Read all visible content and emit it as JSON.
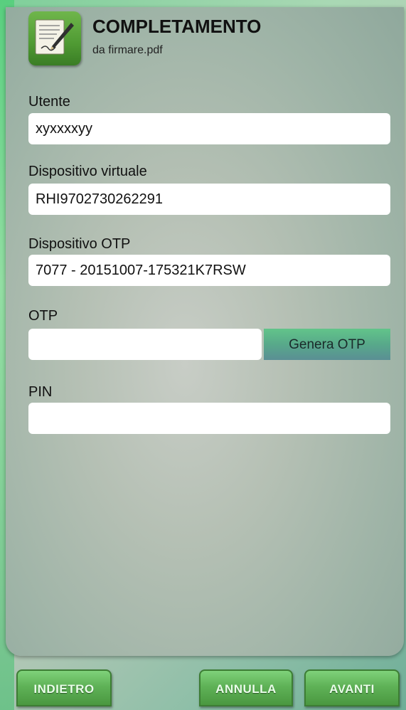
{
  "header": {
    "title": "COMPLETAMENTO",
    "filename": "da firmare.pdf",
    "icon": "document-sign-icon"
  },
  "form": {
    "utente": {
      "label": "Utente",
      "value": "xyxxxxyy"
    },
    "dispositivo_virtuale": {
      "label": "Dispositivo virtuale",
      "value": "RHI9702730262291"
    },
    "dispositivo_otp": {
      "label": "Dispositivo OTP",
      "value": "7077 - 20151007-175321K7RSW"
    },
    "otp": {
      "label": "OTP",
      "value": "",
      "generate_label": "Genera OTP"
    },
    "pin": {
      "label": "PIN",
      "value": ""
    }
  },
  "footer": {
    "back_label": "INDIETRO",
    "cancel_label": "ANNULLA",
    "next_label": "AVANTI"
  }
}
